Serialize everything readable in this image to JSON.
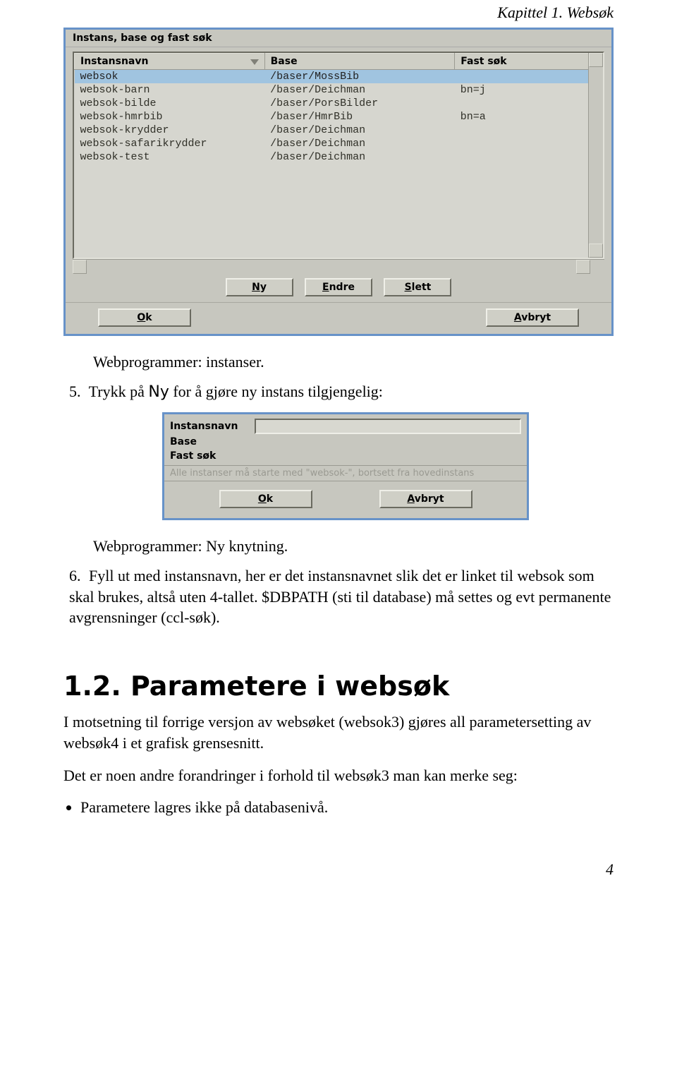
{
  "chapter_header": "Kapittel 1. Websøk",
  "dialog1": {
    "title": "Instans, base og fast søk",
    "headers": [
      "Instansnavn",
      "Base",
      "Fast søk"
    ],
    "rows": [
      {
        "name": "websok",
        "base": "/baser/MossBib",
        "fast": ""
      },
      {
        "name": "websok-barn",
        "base": "/baser/Deichman",
        "fast": "bn=j"
      },
      {
        "name": "websok-bilde",
        "base": "/baser/PorsBilder",
        "fast": ""
      },
      {
        "name": "websok-hmrbib",
        "base": "/baser/HmrBib",
        "fast": "bn=a"
      },
      {
        "name": "websok-krydder",
        "base": "/baser/Deichman",
        "fast": ""
      },
      {
        "name": "websok-safarikrydder",
        "base": "/baser/Deichman",
        "fast": ""
      },
      {
        "name": "websok-test",
        "base": "/baser/Deichman",
        "fast": ""
      }
    ],
    "buttons": {
      "ny": "Ny",
      "endre": "Endre",
      "slett": "Slett",
      "ok": "Ok",
      "avbryt": "Avbryt"
    }
  },
  "caption1": "Webprogrammer: instanser.",
  "step5": {
    "num": "5.",
    "pre": "Trykk på ",
    "btn": "Ny",
    "post": " for å gjøre ny instans tilgjengelig:"
  },
  "dialog2": {
    "labels": {
      "instansnavn": "Instansnavn",
      "base": "Base",
      "fastsok": "Fast søk"
    },
    "hint": "Alle instanser må starte med \"websok-\", bortsett fra hovedinstans",
    "buttons": {
      "ok": "Ok",
      "avbryt": "Avbryt"
    }
  },
  "caption2": "Webprogrammer: Ny knytning.",
  "step6": {
    "num": "6.",
    "text": "Fyll ut med instansnavn, her er det instansnavnet slik det er linket til websok som skal brukes, altså uten 4-tallet. $DBPATH (sti til database) må settes og evt permanente avgrensninger (ccl-søk)."
  },
  "section": {
    "title": "1.2. Parametere i websøk",
    "p1": "I motsetning til forrige versjon av websøket (websok3) gjøres all parametersetting av websøk4 i et grafisk grensesnitt.",
    "p2": "Det er noen andre forandringer i forhold til websøk3 man kan merke seg:",
    "bullet1": "Parametere lagres ikke på databasenivå."
  },
  "page_number": "4"
}
